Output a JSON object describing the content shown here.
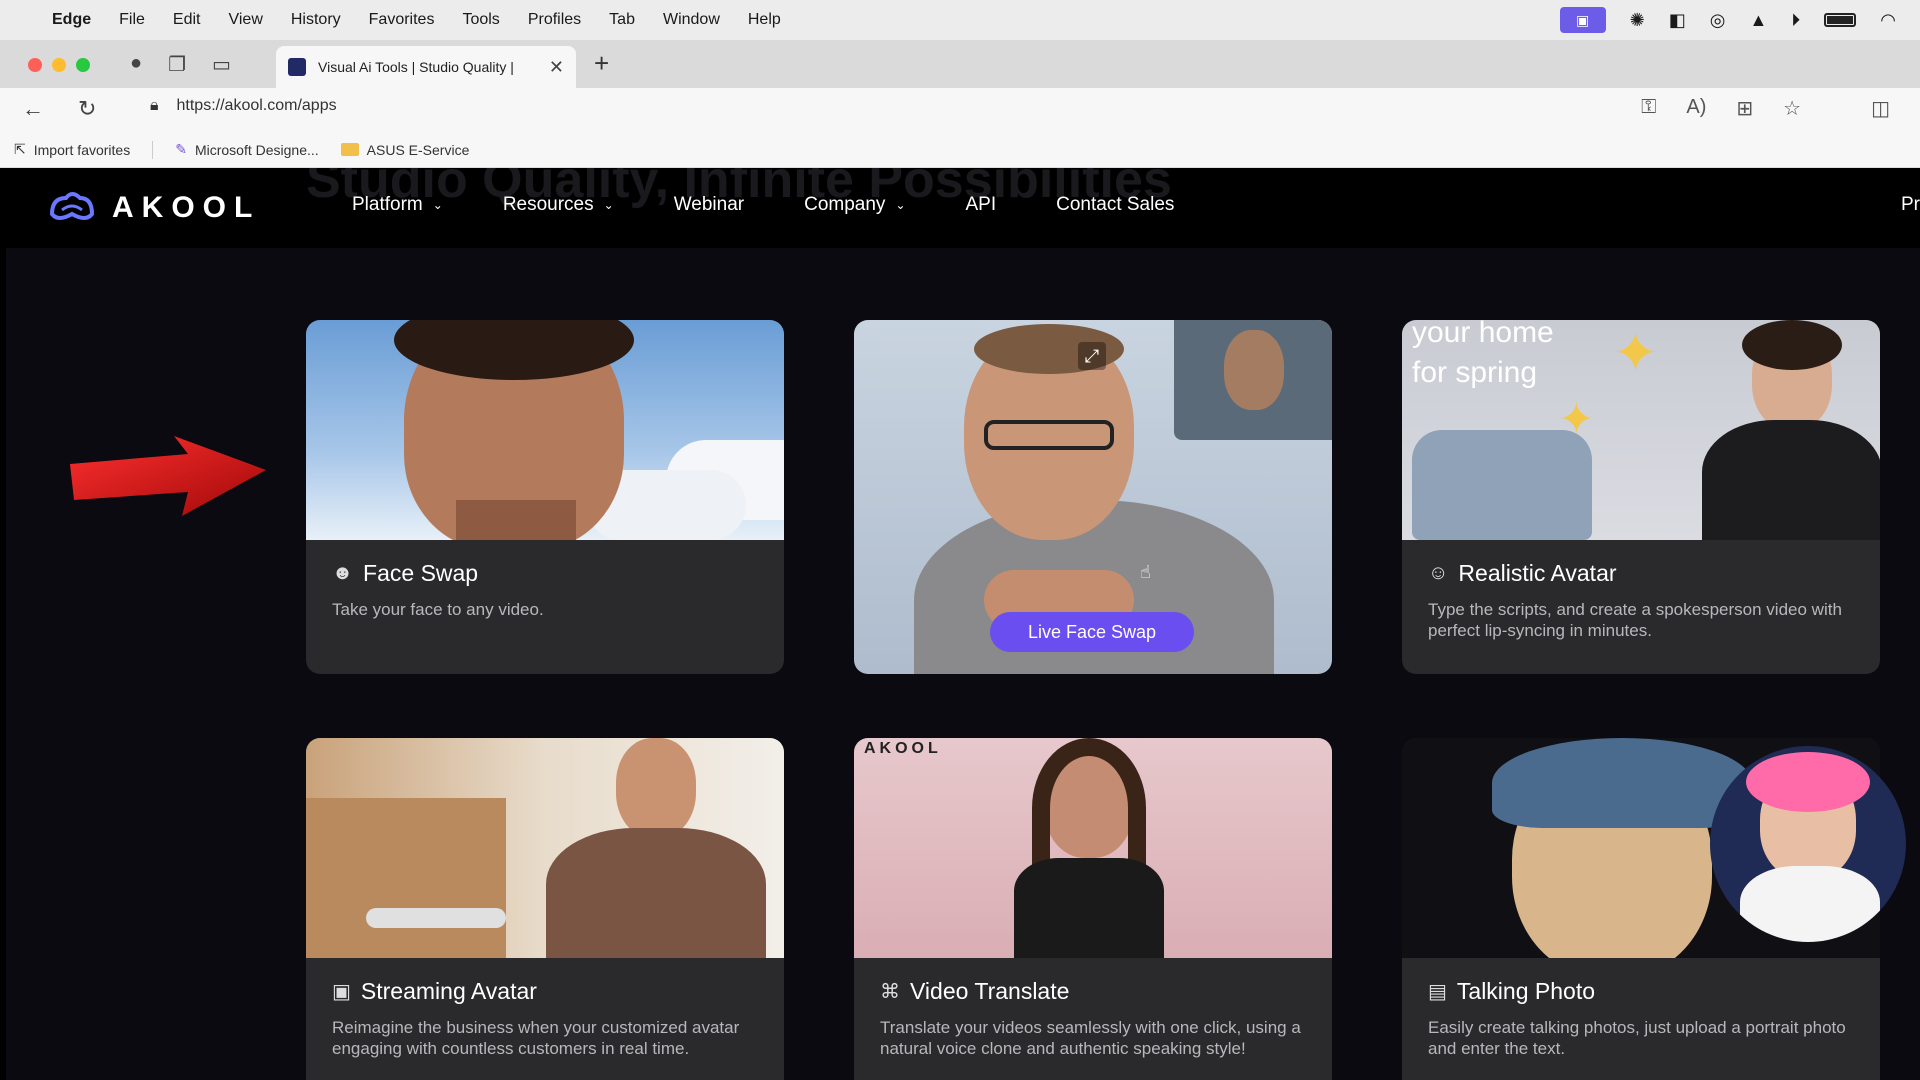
{
  "menubar": {
    "app": "Edge",
    "items": [
      "File",
      "Edit",
      "View",
      "History",
      "Favorites",
      "Tools",
      "Profiles",
      "Tab",
      "Window",
      "Help"
    ]
  },
  "tab": {
    "title": "Visual Ai Tools | Studio Quality |"
  },
  "address": {
    "url": "https://akool.com/apps"
  },
  "favorites": {
    "items": [
      "Import favorites",
      "Microsoft Designe...",
      "ASUS E-Service"
    ]
  },
  "site": {
    "ghost_heading": "Studio Quality, Infinite Possibilities",
    "logo_text": "AKOOL",
    "nav": [
      "Platform",
      "Resources",
      "Webinar",
      "Company",
      "API",
      "Contact Sales"
    ],
    "nav_cut": "Pr"
  },
  "cards": [
    {
      "title": "Face Swap",
      "desc": "Take your face to any video.",
      "icon": "face-swap-icon"
    },
    {
      "title": "",
      "desc": "",
      "button": "Live Face Swap"
    },
    {
      "title": "Realistic Avatar",
      "desc": "Type the scripts, and create a spokesperson video with perfect lip-syncing in minutes.",
      "icon": "avatar-icon"
    },
    {
      "title": "Streaming Avatar",
      "desc": "Reimagine the business when your customized avatar engaging with countless customers in real time.",
      "icon": "streaming-icon"
    },
    {
      "title": "Video Translate",
      "desc": "Translate your videos seamlessly with one click,  using a natural voice clone and authentic speaking style!",
      "icon": "translate-icon"
    },
    {
      "title": "Talking Photo",
      "desc": "Easily create talking photos, just upload a portrait photo and enter the text.",
      "icon": "photo-icon"
    }
  ],
  "card_images": {
    "realistic_text_1": "your home",
    "realistic_text_2": "for spring",
    "video_translate_logo": "AKOOL"
  },
  "colors": {
    "accent": "#6b4ef0",
    "page_bg": "#0a0a10",
    "card_bg": "#2a2a2c"
  }
}
